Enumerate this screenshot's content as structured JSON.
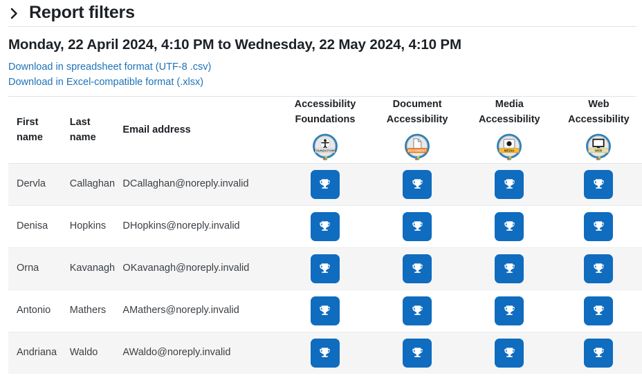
{
  "filters": {
    "toggle_icon": "chevron-right-icon",
    "title": "Report filters"
  },
  "date_range": "Monday, 22 April 2024, 4:10 PM to Wednesday, 22 May 2024, 4:10 PM",
  "downloads": [
    {
      "label": "Download in spreadsheet format (UTF-8 .csv)"
    },
    {
      "label": "Download in Excel-compatible format (.xlsx)"
    }
  ],
  "colors": {
    "link": "#1d73b8",
    "badge_button": "#0f6cbf",
    "stripe_row": "#f5f5f5",
    "divider": "#dee2e6",
    "text": "#1d2125"
  },
  "table": {
    "headers": {
      "first_name": "First name",
      "first_name_line1": "First",
      "first_name_line2": "name",
      "last_name_line1": "Last",
      "last_name_line2": "name",
      "email": "Email address"
    },
    "badge_columns": [
      {
        "line1": "Accessibility",
        "line2": "Foundations",
        "emblem_icon": "accessibility-foundations-badge-icon",
        "emblem_ribbon_text": "FOUNDATIONS",
        "emblem_ribbon_color": "#f2f2f2"
      },
      {
        "line1": "Document",
        "line2": "Accessibility",
        "emblem_icon": "document-accessibility-badge-icon",
        "emblem_ribbon_text": "DOCUMENT",
        "emblem_ribbon_color": "#f0862e"
      },
      {
        "line1": "Media",
        "line2": "Accessibility",
        "emblem_icon": "media-accessibility-badge-icon",
        "emblem_ribbon_text": "MEDIA",
        "emblem_ribbon_color": "#f5b841"
      },
      {
        "line1": "Web",
        "line2": "Accessibility",
        "emblem_icon": "web-accessibility-badge-icon",
        "emblem_ribbon_text": "WEB",
        "emblem_ribbon_color": "#e8dfa8"
      }
    ],
    "rows": [
      {
        "first_name": "Dervla",
        "last_name": "Callaghan",
        "email": "DCallaghan@noreply.invalid",
        "awards": [
          "trophy-icon",
          "trophy-icon",
          "trophy-icon",
          "trophy-icon"
        ]
      },
      {
        "first_name": "Denisa",
        "last_name": "Hopkins",
        "email": "DHopkins@noreply.invalid",
        "awards": [
          "trophy-icon",
          "trophy-icon",
          "trophy-icon",
          "trophy-icon"
        ]
      },
      {
        "first_name": "Orna",
        "last_name": "Kavanagh",
        "email": "OKavanagh@noreply.invalid",
        "awards": [
          "trophy-icon",
          "trophy-icon",
          "trophy-icon",
          "trophy-icon"
        ]
      },
      {
        "first_name": "Antonio",
        "last_name": "Mathers",
        "email": "AMathers@noreply.invalid",
        "awards": [
          "trophy-icon",
          "trophy-icon",
          "trophy-icon",
          "trophy-icon"
        ]
      },
      {
        "first_name": "Andriana",
        "last_name": "Waldo",
        "email": "AWaldo@noreply.invalid",
        "awards": [
          "trophy-icon",
          "trophy-icon",
          "trophy-icon",
          "trophy-icon"
        ]
      }
    ]
  }
}
